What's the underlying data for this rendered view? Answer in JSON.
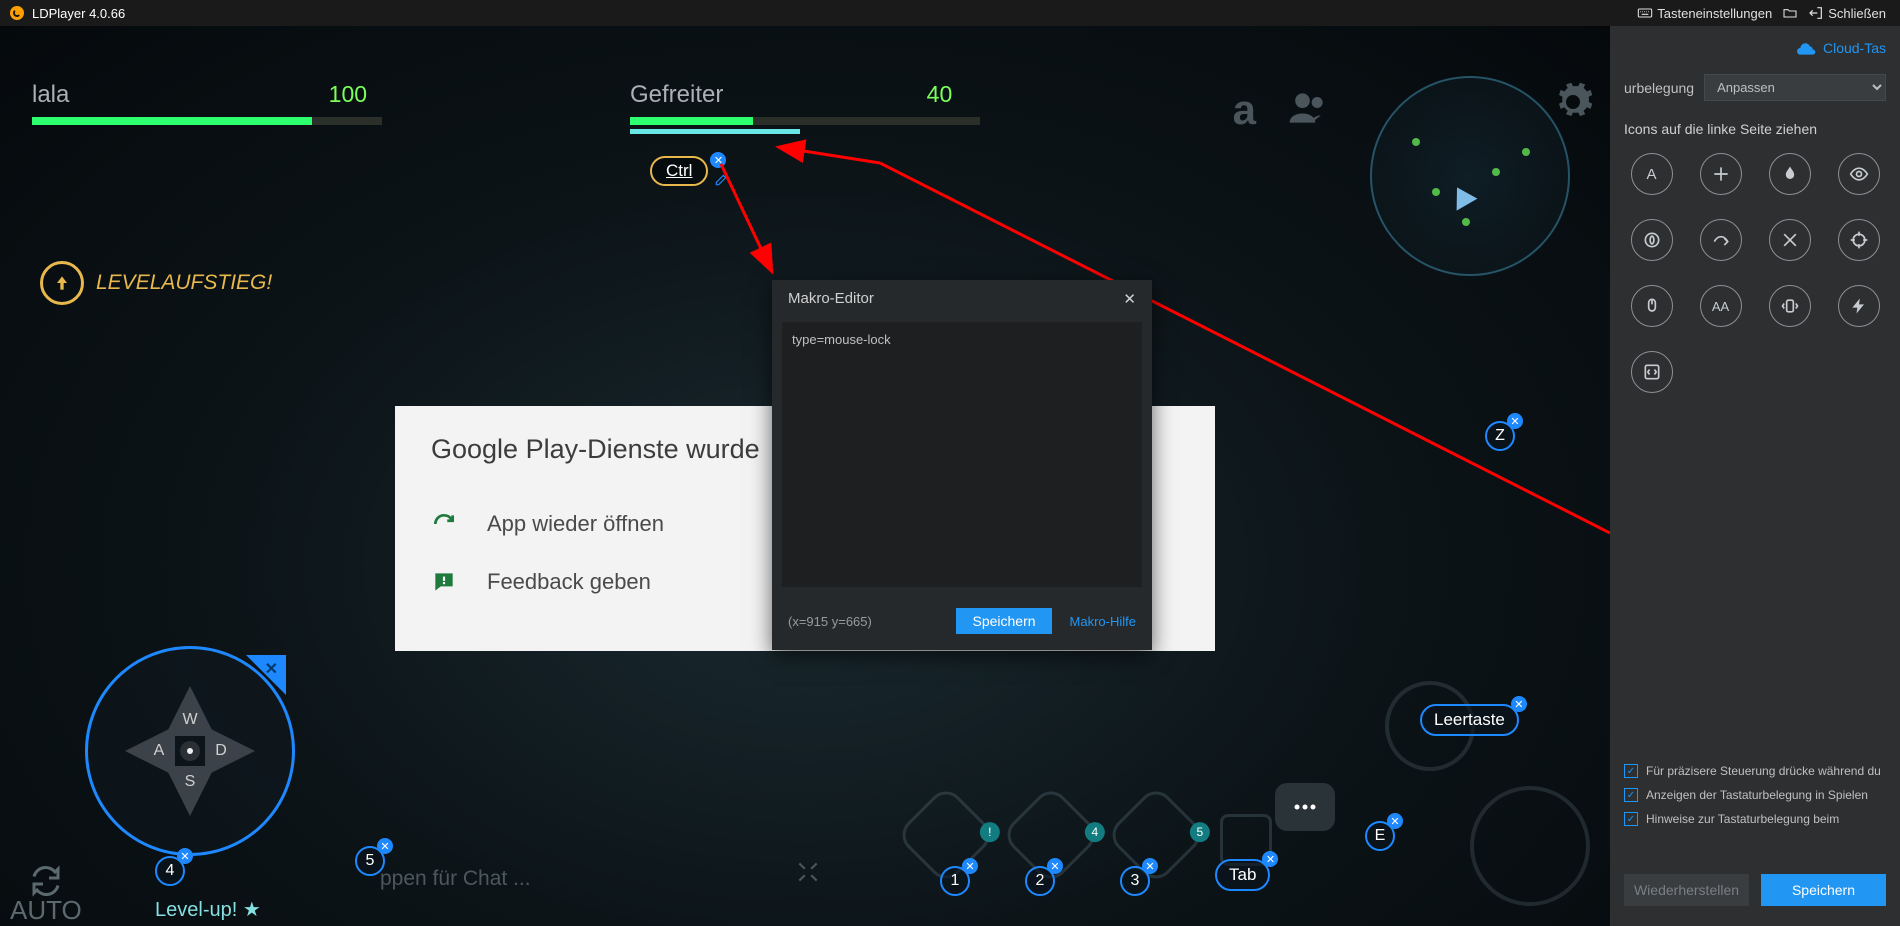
{
  "app": {
    "title": "LDPlayer 4.0.66"
  },
  "titlebar": {
    "keyboard_settings": "Tasteneinstellungen",
    "close": "Schließen"
  },
  "hud": {
    "player1": {
      "name": "lala",
      "score": "100"
    },
    "player2": {
      "name": "Gefreiter",
      "score": "40"
    },
    "levelup": "LEVELAUFSTIEG!",
    "auto": "AUTO",
    "chat_hint": "ppen für Chat ...",
    "levelup_bottom": "Level-up!"
  },
  "dpad": {
    "n": "W",
    "s": "S",
    "w": "A",
    "e": "D"
  },
  "keys": {
    "ctrl": "Ctrl",
    "z": "Z",
    "space": "Leertaste",
    "e": "E",
    "tab": "Tab",
    "one": "1",
    "two": "2",
    "three": "3",
    "four": "4",
    "five": "5"
  },
  "play_dialog": {
    "title": "Google Play-Dienste wurde",
    "retry": "App wieder öffnen",
    "feedback": "Feedback geben"
  },
  "macro": {
    "title": "Makro-Editor",
    "content": "type=mouse-lock",
    "coords": "(x=915  y=665)",
    "save": "Speichern",
    "help": "Makro-Hilfe"
  },
  "sidepanel": {
    "cloud": "Cloud-Tas",
    "belegung_label": "urbelegung",
    "belegung_value": "Anpassen",
    "drag_hint": "Icons auf die linke Seite ziehen",
    "chk1": "Für präzisere Steuerung drücke während du",
    "chk2": "Anzeigen der Tastaturbelegung in Spielen",
    "chk3": "Hinweise zur Tastaturbelegung beim",
    "restore": "Wiederherstellen",
    "save": "Speichern"
  },
  "ghost_badges": {
    "b1": "!",
    "b2": "4",
    "b3": "5"
  }
}
